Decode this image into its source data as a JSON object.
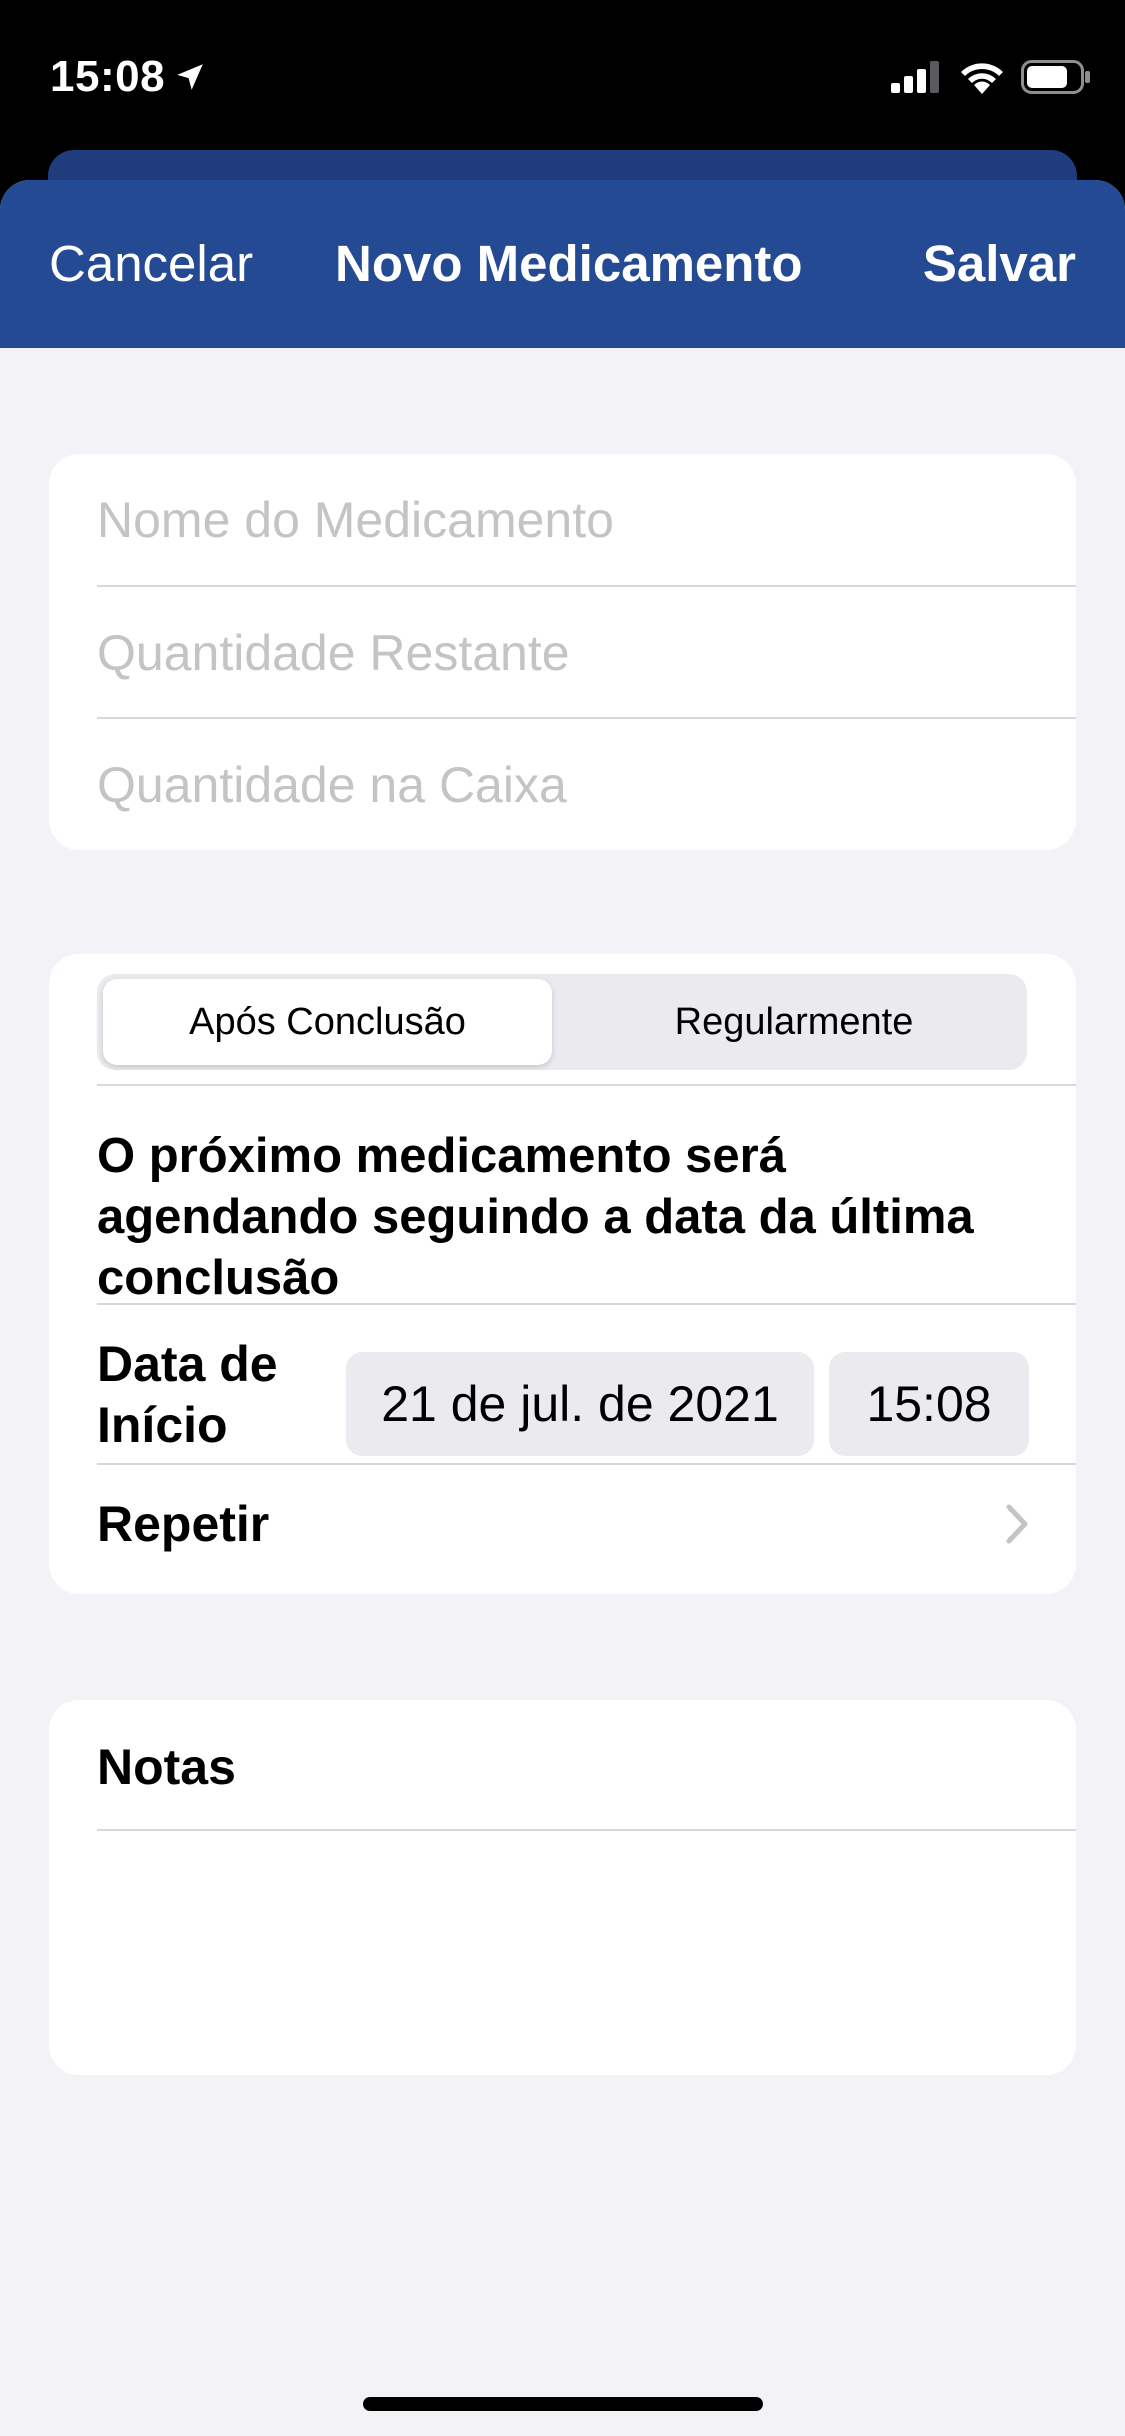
{
  "status_bar": {
    "time": "15:08",
    "icons": [
      "location-arrow-icon",
      "cellular-signal-icon",
      "wifi-icon",
      "battery-icon"
    ]
  },
  "nav": {
    "cancel": "Cancelar",
    "title": "Novo Medicamento",
    "save": "Salvar"
  },
  "form": {
    "name_placeholder": "Nome do Medicamento",
    "remaining_placeholder": "Quantidade Restante",
    "box_placeholder": "Quantidade na Caixa"
  },
  "schedule": {
    "segments": [
      "Após Conclusão",
      "Regularmente"
    ],
    "selected_segment": "Após Conclusão",
    "description": "O próximo medicamento será agendando seguindo a data da última conclusão",
    "start_label": "Data de Início",
    "start_date": "21 de jul. de 2021",
    "start_time": "15:08",
    "repeat_label": "Repetir",
    "repeat_icon": "chevron-right-icon"
  },
  "notes": {
    "title": "Notas"
  },
  "colors": {
    "nav_background": "#234a93",
    "page_background": "#f2f2f7",
    "card_background": "#ffffff",
    "placeholder": "#c4c4c7"
  }
}
